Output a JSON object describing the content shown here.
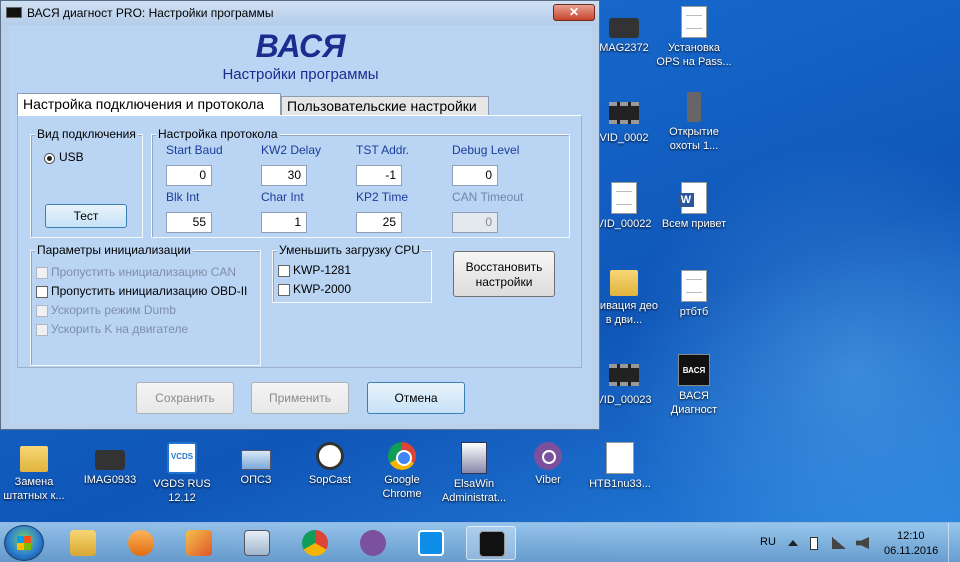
{
  "window": {
    "title": "ВАСЯ диагност PRO:  Настройки программы",
    "close_label": "✕",
    "app_title": "ВАСЯ",
    "app_subtitle": "Настройки программы",
    "tabs": [
      {
        "label": "Настройка подключения и протокола",
        "active": true
      },
      {
        "label": "Пользовательские настройки",
        "active": false
      }
    ],
    "connection": {
      "group_label": "Вид подключения",
      "radio_label": "USB",
      "radio_checked": true,
      "test_button": "Тест"
    },
    "protocol": {
      "group_label": "Настройка протокола",
      "fields": [
        {
          "label": "Start Baud",
          "value": "0",
          "enabled": true
        },
        {
          "label": "KW2 Delay",
          "value": "30",
          "enabled": true
        },
        {
          "label": "TST Addr.",
          "value": "-1",
          "enabled": true
        },
        {
          "label": "Debug Level",
          "value": "0",
          "enabled": true
        },
        {
          "label": "Blk Int",
          "value": "55",
          "enabled": true
        },
        {
          "label": "Char Int",
          "value": "1",
          "enabled": true
        },
        {
          "label": "KP2 Time",
          "value": "25",
          "enabled": true
        },
        {
          "label": "CAN Timeout",
          "value": "0",
          "enabled": false
        }
      ]
    },
    "init": {
      "group_label": "Параметры инициализации",
      "options": [
        {
          "label": "Пропустить инициализацию CAN",
          "enabled": false
        },
        {
          "label": "Пропустить инициализацию OBD-II",
          "enabled": true
        },
        {
          "label": "Ускорить режим Dumb",
          "enabled": false
        },
        {
          "label": "Ускорить K на двигателе",
          "enabled": false
        }
      ]
    },
    "cpu": {
      "group_label": "Уменьшить загрузку CPU",
      "options": [
        {
          "label": "KWP-1281"
        },
        {
          "label": "KWP-2000"
        }
      ]
    },
    "restore_button": {
      "line1": "Восстановить",
      "line2": "настройки"
    },
    "footer": {
      "save": "Сохранить",
      "apply": "Применить",
      "cancel": "Отмена"
    }
  },
  "desktop": {
    "right_icons": [
      {
        "label": "MAG2372",
        "icon": "camera-icon"
      },
      {
        "label": "Установка OPS на Pass...",
        "icon": "document-icon"
      },
      {
        "label": "VID_0002",
        "icon": "video-icon"
      },
      {
        "label": "Открытие охоты 1...",
        "icon": "phone-icon"
      },
      {
        "label": "VID_00022",
        "icon": "document-icon"
      },
      {
        "label": "Всем привет",
        "icon": "word-icon"
      },
      {
        "label": "ктивация део в дви...",
        "icon": "folder-icon"
      },
      {
        "label": "ртбтб",
        "icon": "document-icon"
      },
      {
        "label": "VID_00023",
        "icon": "video-icon"
      },
      {
        "label": "ВАСЯ Диагност",
        "icon": "vasya-icon"
      }
    ],
    "bottom_icons": [
      {
        "label": "Замена штатных к...",
        "icon": "folder-icon"
      },
      {
        "label": "IMAG0933",
        "icon": "camera-icon"
      },
      {
        "label": "VGDS RUS 12.12",
        "icon": "vcds-icon"
      },
      {
        "label": "ОПСЗ",
        "icon": "ops-icon"
      },
      {
        "label": "SopCast",
        "icon": "sopcast-icon"
      },
      {
        "label": "Google Chrome",
        "icon": "chrome-icon"
      },
      {
        "label": "ElsaWin Administrat...",
        "icon": "elsawin-icon"
      },
      {
        "label": "Viber",
        "icon": "viber-icon"
      },
      {
        "label": "HTB1nu33...",
        "icon": "document-icon"
      }
    ]
  },
  "taskbar": {
    "apps": [
      "explorer-icon",
      "media-player-icon",
      "paint-icon",
      "calculator-icon",
      "chrome-icon",
      "viber-icon",
      "teamviewer-icon",
      "vasya-icon"
    ],
    "lang": "RU",
    "time": "12:10",
    "date": "06.11.2016",
    "colors": {
      "accent": "#1a2d8f",
      "window_bg": "#bad4f3"
    }
  }
}
